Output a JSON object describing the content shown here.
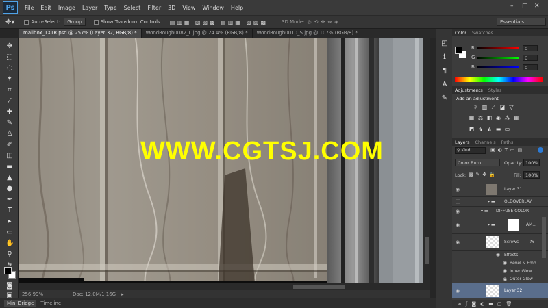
{
  "app": {
    "logo": "Ps"
  },
  "menu": [
    "File",
    "Edit",
    "Image",
    "Layer",
    "Type",
    "Select",
    "Filter",
    "3D",
    "View",
    "Window",
    "Help"
  ],
  "window_controls": [
    "–",
    "□",
    "✕"
  ],
  "options": {
    "auto_select_label": "Auto-Select:",
    "auto_select_value": "Group",
    "show_transform": "Show Transform Controls",
    "mode_3d": "3D Mode:",
    "workspace": "Essentials"
  },
  "doc_tabs": [
    {
      "label": "mailbox_TXTR.psd @ 257% (Layer 32, RGB/8) *",
      "active": true
    },
    {
      "label": "WoodRough0082_L.jpg @ 24.4% (RGB/8) *",
      "active": false
    },
    {
      "label": "WoodRough0010_S.jpg @ 107% (RGB/8) *",
      "active": false
    }
  ],
  "status": {
    "zoom": "256.99%",
    "doc": "Doc: 12.0M/1.16G"
  },
  "bottom_tabs": [
    "Mini Bridge",
    "Timeline"
  ],
  "color_panel": {
    "tabs": [
      "Color",
      "Swatches"
    ],
    "channels": [
      {
        "label": "R",
        "value": "0"
      },
      {
        "label": "G",
        "value": "0"
      },
      {
        "label": "B",
        "value": "0"
      }
    ]
  },
  "adjustments_panel": {
    "tabs": [
      "Adjustments",
      "Styles"
    ],
    "title": "Add an adjustment"
  },
  "layers_panel": {
    "tabs": [
      "Layers",
      "Channels",
      "Paths"
    ],
    "kind": "Kind",
    "blend_mode": "Color Burn",
    "opacity_label": "Opacity:",
    "opacity": "100%",
    "lock_label": "Lock:",
    "fill_label": "Fill:",
    "fill": "100%",
    "layers": [
      {
        "name": "Layer 31"
      },
      {
        "name": "OLDOVERLAY"
      },
      {
        "name": "DIFFUSE COLOR"
      },
      {
        "name": "AM..."
      },
      {
        "name": "Screws",
        "fx": "fx"
      },
      {
        "name": "Effects"
      },
      {
        "name": "Bevel & Emb..."
      },
      {
        "name": "Inner Glow"
      },
      {
        "name": "Outer Glow"
      },
      {
        "name": "Layer 32"
      }
    ]
  },
  "watermark": "WWW.CGTSJ.COM"
}
